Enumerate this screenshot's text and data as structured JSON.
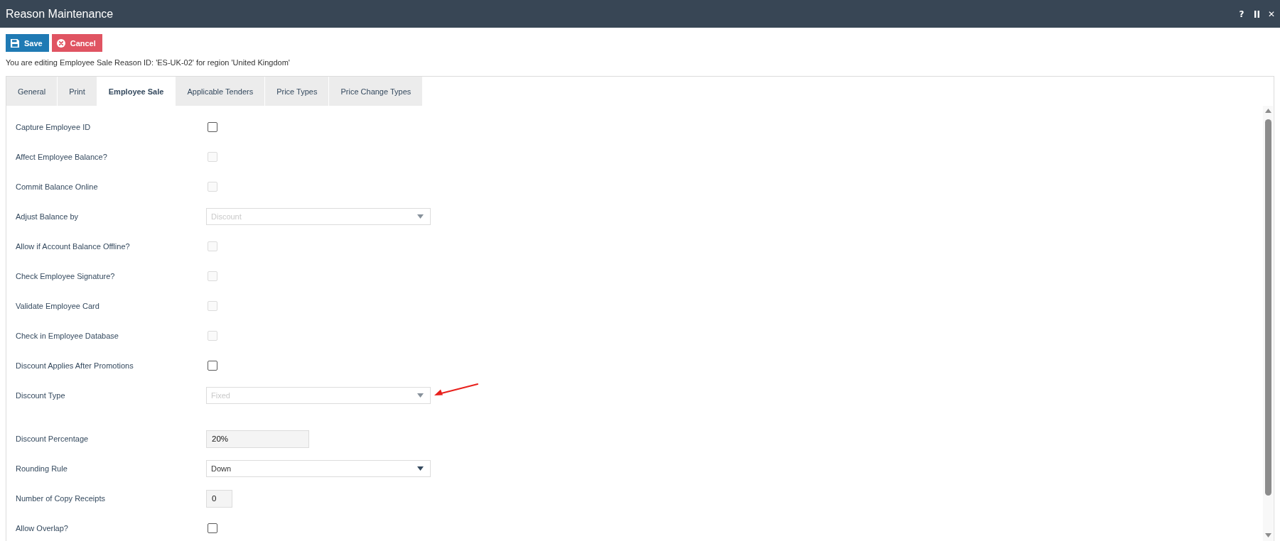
{
  "window": {
    "title": "Reason Maintenance",
    "controls": [
      {
        "kind": "help",
        "glyph": "?"
      },
      {
        "kind": "pause"
      },
      {
        "kind": "close",
        "glyph": "✕"
      }
    ]
  },
  "toolbar": {
    "buttons": [
      {
        "kind": "save",
        "label": "Save"
      },
      {
        "kind": "cancel",
        "label": "Cancel"
      }
    ]
  },
  "info": "You are editing Employee Sale Reason ID: 'ES-UK-02' for region 'United Kingdom'",
  "tabs": [
    {
      "label": "General",
      "selected": false
    },
    {
      "label": "Print",
      "selected": false
    },
    {
      "label": "Employee Sale",
      "selected": true
    },
    {
      "label": "Applicable Tenders",
      "selected": false
    },
    {
      "label": "Price Types",
      "selected": false
    },
    {
      "label": "Price Change Types",
      "selected": false
    }
  ],
  "fields": [
    {
      "label": "Capture Employee ID",
      "kind": "checkbox",
      "checked": false,
      "disabled": false
    },
    {
      "label": "Affect Employee Balance?",
      "kind": "checkbox",
      "checked": false,
      "disabled": true
    },
    {
      "label": "Commit Balance Online",
      "kind": "checkbox",
      "checked": false,
      "disabled": true
    },
    {
      "label": "Adjust Balance by",
      "kind": "select",
      "value": "Discount",
      "disabled": true
    },
    {
      "label": "Allow if Account Balance Offline?",
      "kind": "checkbox",
      "checked": false,
      "disabled": true
    },
    {
      "label": "Check Employee Signature?",
      "kind": "checkbox",
      "checked": false,
      "disabled": true
    },
    {
      "label": "Validate Employee Card",
      "kind": "checkbox",
      "checked": false,
      "disabled": true
    },
    {
      "label": "Check in Employee Database",
      "kind": "checkbox",
      "checked": false,
      "disabled": true
    },
    {
      "label": "Discount Applies After Promotions",
      "kind": "checkbox",
      "checked": false,
      "disabled": false
    },
    {
      "label": "Discount Type",
      "kind": "select",
      "value": "Fixed",
      "disabled": true,
      "annotated": true
    },
    {
      "label": "Discount Percentage",
      "kind": "text",
      "value": "20%"
    },
    {
      "label": "Rounding Rule",
      "kind": "select",
      "value": "Down",
      "disabled": false
    },
    {
      "label": "Number of Copy Receipts",
      "kind": "number",
      "value": "0"
    },
    {
      "label": "Allow Overlap?",
      "kind": "checkbox",
      "checked": false,
      "disabled": false
    }
  ]
}
